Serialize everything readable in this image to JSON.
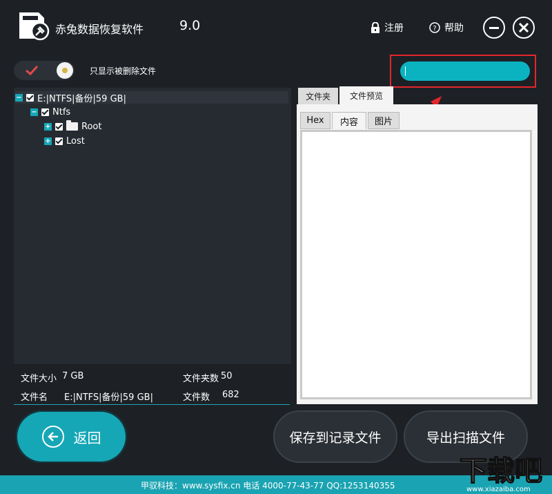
{
  "header": {
    "app_title": "赤兔数据恢复软件",
    "version": "9.0",
    "register_label": "注册",
    "help_label": "帮助"
  },
  "filter": {
    "toggle_label": "只显示被删除文件",
    "toggle_on": true
  },
  "search": {
    "value": ""
  },
  "tree": {
    "root_label": "E:|NTFS|备份|59 GB|",
    "ntfs_label": "Ntfs",
    "children": [
      "Root",
      "Lost"
    ]
  },
  "info": {
    "size_label": "文件大小",
    "size_value": "7 GB",
    "folders_label": "文件夹数",
    "folders_value": "50",
    "name_label": "文件名",
    "name_value": "E:|NTFS|备份|59 GB|",
    "files_label": "文件数",
    "files_value": "682"
  },
  "tabs": {
    "folder": "文件夹",
    "preview": "文件预览"
  },
  "preview_tabs": {
    "hex": "Hex",
    "content": "内容",
    "image": "图片"
  },
  "buttons": {
    "back": "返回",
    "save_record": "保存到记录文件",
    "export_scan": "导出扫描文件"
  },
  "footer": {
    "text": "甲驭科技：www.sysfix.cn 电话 4000-77-43-77 QQ:1253140355"
  },
  "watermark": {
    "text": "下载吧",
    "url": "www.xiazaiba.com"
  },
  "colors": {
    "background": "#1d2126",
    "accent": "#15a7b6",
    "highlight": "#e5262b"
  }
}
